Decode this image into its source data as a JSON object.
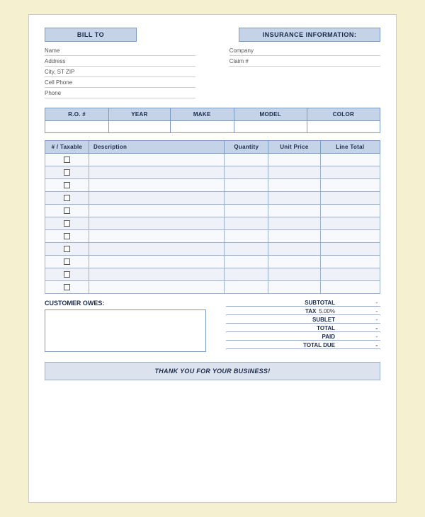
{
  "header": {
    "bill_to_label": "BILL TO",
    "insurance_label": "INSURANCE INFORMATION:"
  },
  "bill_fields": [
    {
      "label": "Name",
      "value": ""
    },
    {
      "label": "Address",
      "value": ""
    },
    {
      "label": "City, ST ZIP",
      "value": ""
    },
    {
      "label": "Cell Phone",
      "value": ""
    },
    {
      "label": "Phone",
      "value": ""
    }
  ],
  "insurance_fields": [
    {
      "label": "Company",
      "value": ""
    },
    {
      "label": "Claim #",
      "value": ""
    }
  ],
  "vehicle_table": {
    "headers": [
      "R.O. #",
      "YEAR",
      "MAKE",
      "MODEL",
      "COLOR"
    ],
    "row": [
      "",
      "",
      "",
      "",
      ""
    ]
  },
  "items_table": {
    "headers": {
      "number_taxable": "# / Taxable",
      "description": "Description",
      "quantity": "Quantity",
      "unit_price": "Unit Price",
      "line_total": "Line Total"
    },
    "rows": [
      {
        "num": "",
        "desc": "",
        "qty": "",
        "price": "",
        "total": ""
      },
      {
        "num": "",
        "desc": "",
        "qty": "",
        "price": "",
        "total": ""
      },
      {
        "num": "",
        "desc": "",
        "qty": "",
        "price": "",
        "total": ""
      },
      {
        "num": "",
        "desc": "",
        "qty": "",
        "price": "",
        "total": ""
      },
      {
        "num": "",
        "desc": "",
        "qty": "",
        "price": "",
        "total": ""
      },
      {
        "num": "",
        "desc": "",
        "qty": "",
        "price": "",
        "total": ""
      },
      {
        "num": "",
        "desc": "",
        "qty": "",
        "price": "",
        "total": ""
      },
      {
        "num": "",
        "desc": "",
        "qty": "",
        "price": "",
        "total": ""
      },
      {
        "num": "",
        "desc": "",
        "qty": "",
        "price": "",
        "total": ""
      },
      {
        "num": "",
        "desc": "",
        "qty": "",
        "price": "",
        "total": ""
      },
      {
        "num": "",
        "desc": "",
        "qty": "",
        "price": "",
        "total": ""
      }
    ]
  },
  "totals": {
    "subtotal_label": "SUBTOTAL",
    "subtotal_value": "-",
    "tax_label": "TAX",
    "tax_pct": "5.00%",
    "tax_value": "-",
    "sublet_label": "SUBLET",
    "sublet_value": "-",
    "total_label": "TOTAL",
    "total_value": "-",
    "paid_label": "PAID",
    "paid_value": "-",
    "total_due_label": "TOTAL DUE",
    "total_due_value": "-"
  },
  "customer_owes": {
    "label": "CUSTOMER OWES:"
  },
  "footer": {
    "text": "THANK YOU FOR YOUR BUSINESS!"
  }
}
